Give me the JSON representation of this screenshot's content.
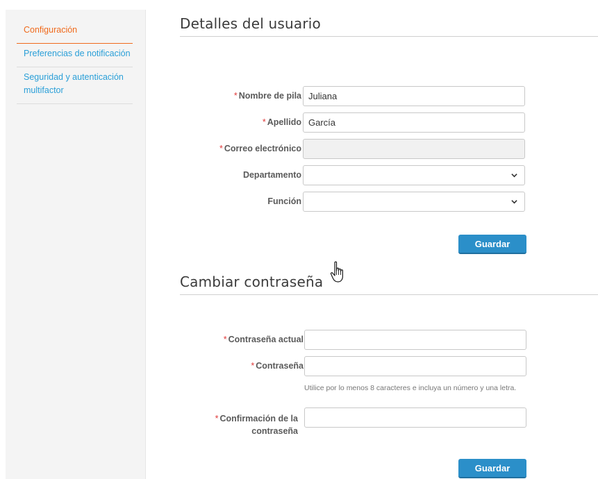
{
  "sidebar": {
    "items": [
      {
        "label": "Configuración"
      },
      {
        "label": "Preferencias de notificación"
      },
      {
        "label": "Seguridad y autenticación multifactor"
      }
    ]
  },
  "details": {
    "title": "Detalles del usuario",
    "first_name": {
      "label": "Nombre de pila",
      "value": "Juliana"
    },
    "last_name": {
      "label": "Apellido",
      "value": "García"
    },
    "email": {
      "label": "Correo electrónico",
      "value": ""
    },
    "department": {
      "label": "Departamento",
      "value": ""
    },
    "role": {
      "label": "Función",
      "value": ""
    },
    "save_label": "Guardar"
  },
  "password": {
    "title": "Cambiar contraseña",
    "current": {
      "label": "Contraseña actual",
      "value": ""
    },
    "new": {
      "label": "Contraseña",
      "value": ""
    },
    "hint": "Utilice por lo menos 8 caracteres e incluya un número y una letra.",
    "confirm": {
      "label_line1": "Confirmación de la",
      "label_line2": "contraseña",
      "value": ""
    },
    "save_label": "Guardar"
  },
  "required_marker": "*",
  "colors": {
    "accent": "#2b8fc9",
    "active": "#f06a1c",
    "required": "#e03a3a",
    "link": "#2a9fd8"
  }
}
